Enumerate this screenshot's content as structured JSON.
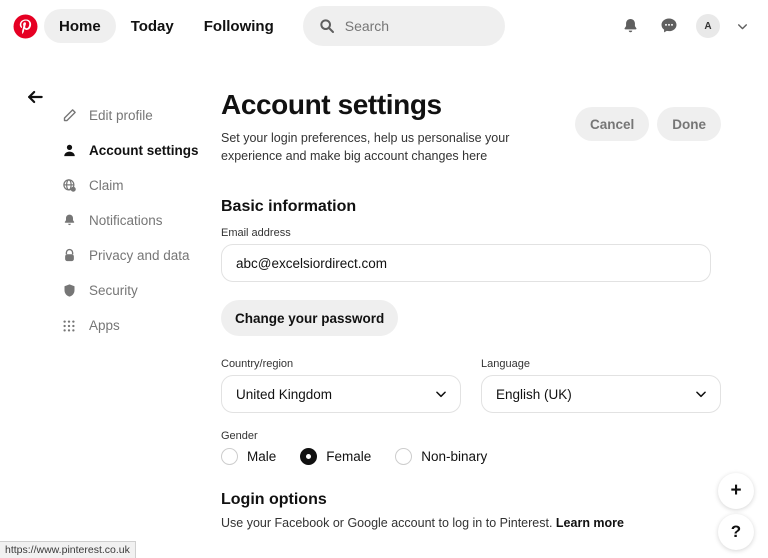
{
  "header": {
    "logo_icon": "pinterest-logo-icon",
    "nav": [
      {
        "label": "Home",
        "active": true
      },
      {
        "label": "Today",
        "active": false
      },
      {
        "label": "Following",
        "active": false
      }
    ],
    "search": {
      "icon": "search-icon",
      "placeholder": "Search"
    },
    "icons": [
      {
        "name": "notifications-bell-icon"
      },
      {
        "name": "messages-chat-icon"
      }
    ],
    "avatar_letter": "A",
    "account_chevron_icon": "chevron-down-icon"
  },
  "back_arrow_icon": "arrow-left-icon",
  "sidebar": {
    "items": [
      {
        "label": "Edit profile",
        "icon": "pencil-icon",
        "active": false
      },
      {
        "label": "Account settings",
        "icon": "person-icon",
        "active": true
      },
      {
        "label": "Claim",
        "icon": "globe-icon",
        "active": false
      },
      {
        "label": "Notifications",
        "icon": "bell-icon",
        "active": false
      },
      {
        "label": "Privacy and data",
        "icon": "lock-icon",
        "active": false
      },
      {
        "label": "Security",
        "icon": "shield-icon",
        "active": false
      },
      {
        "label": "Apps",
        "icon": "grid-apps-icon",
        "active": false
      }
    ]
  },
  "main": {
    "title": "Account settings",
    "subtitle": "Set your login preferences, help us personalise your experience and make big account changes here",
    "cancel_label": "Cancel",
    "done_label": "Done",
    "basic_info": {
      "heading": "Basic information",
      "email_label": "Email address",
      "email_value": "abc@excelsiordirect.com",
      "email_placeholder": "Email address",
      "change_password_label": "Change your password",
      "country_label": "Country/region",
      "country_value": "United Kingdom",
      "language_label": "Language",
      "language_value": "English (UK)",
      "gender_label": "Gender",
      "gender_options": [
        {
          "label": "Male",
          "selected": false
        },
        {
          "label": "Female",
          "selected": true
        },
        {
          "label": "Non-binary",
          "selected": false
        }
      ]
    },
    "login_options": {
      "heading": "Login options",
      "description": "Use your Facebook or Google account to log in to Pinterest.",
      "learn_more": "Learn more"
    }
  },
  "floating": {
    "create_label": "+",
    "help_label": "?"
  },
  "statusbar": {
    "url": "https://www.pinterest.co.uk"
  },
  "colors": {
    "brand_red": "#E60023",
    "accent_dark": "#111111",
    "muted": "#767676",
    "field_bg": "#EFEFEF"
  }
}
